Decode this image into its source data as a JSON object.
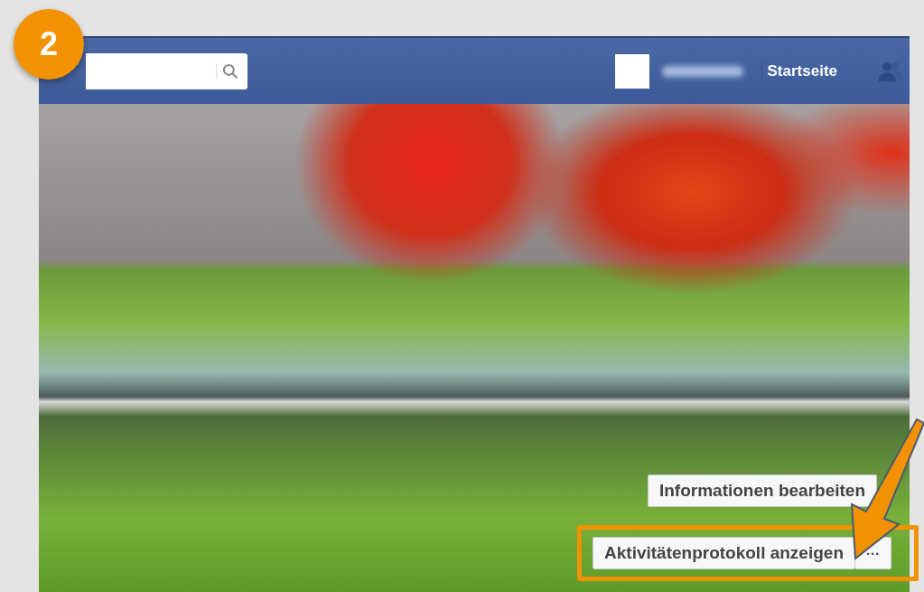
{
  "step_badge": "2",
  "header": {
    "nav": [
      {
        "label": "Startseite"
      }
    ]
  },
  "cover": {
    "buttons": [
      {
        "label": "Informationen bearbeiten",
        "kind": "single"
      },
      {
        "label": "Aktivitätenprotokoll anzeigen",
        "kind": "split",
        "more": "···",
        "highlighted": true
      }
    ]
  }
}
